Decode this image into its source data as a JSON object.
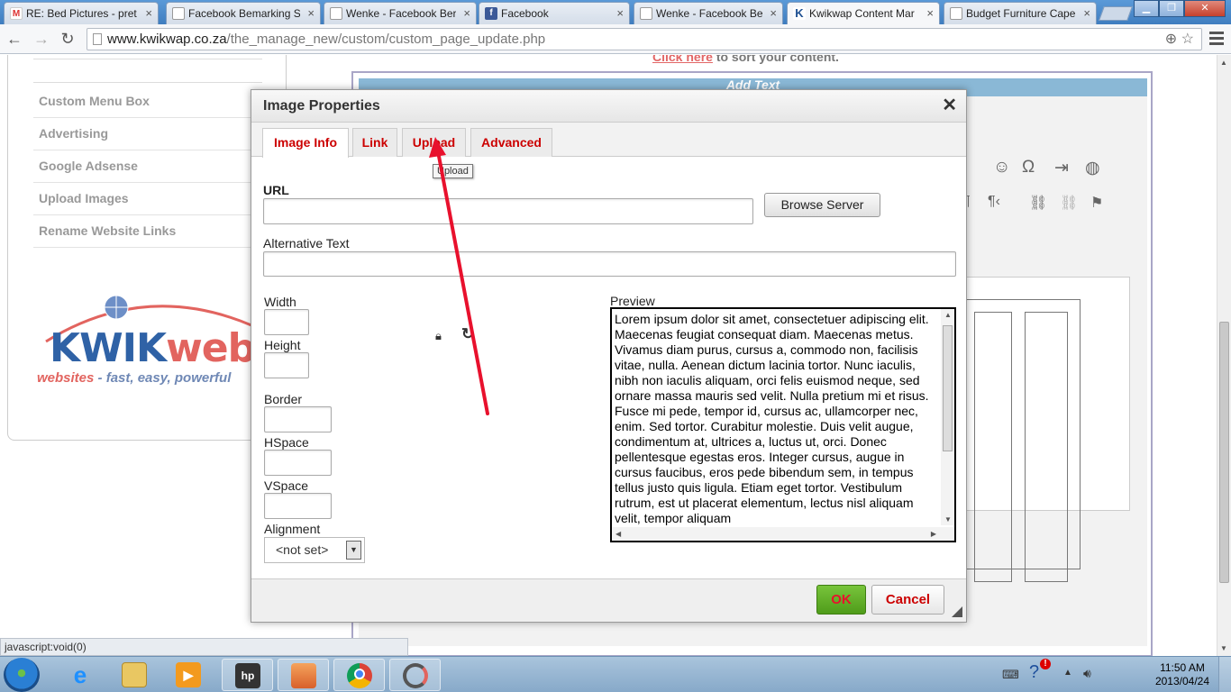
{
  "browser": {
    "tabs": [
      {
        "title": "RE: Bed Pictures - pret",
        "favicon": "gmail-icon",
        "active": false
      },
      {
        "title": "Facebook Bemarking S",
        "favicon": "document-icon",
        "active": false
      },
      {
        "title": "Wenke - Facebook Ber",
        "favicon": "document-icon",
        "active": false
      },
      {
        "title": "Facebook",
        "favicon": "facebook-icon",
        "active": false
      },
      {
        "title": "Wenke - Facebook Be",
        "favicon": "document-icon",
        "active": false
      },
      {
        "title": "Kwikwap Content Mar",
        "favicon": "kwikwap-icon",
        "active": true
      },
      {
        "title": "Budget Furniture Cape",
        "favicon": "document-icon",
        "active": false
      }
    ],
    "url_domain": "www.kwikwap.co.za",
    "url_path": "/the_manage_new/custom/custom_page_update.php",
    "status_text": "javascript:void(0)"
  },
  "sidebar": {
    "items": [
      {
        "label": "Custom Menu Box"
      },
      {
        "label": "Advertising"
      },
      {
        "label": "Google Adsense"
      },
      {
        "label": "Upload Images"
      },
      {
        "label": "Rename Website Links"
      }
    ],
    "logo_word_a": "KWIK",
    "logo_word_b": "web",
    "logo_tag_a": "websites",
    "logo_tag_b": " - fast, easy, powerful"
  },
  "main": {
    "sort_link": "Click here",
    "sort_text": " to sort your content.",
    "editor_header": "Add Text"
  },
  "dialog": {
    "title": "Image Properties",
    "tabs": [
      {
        "label": "Image Info",
        "active": true
      },
      {
        "label": "Link",
        "active": false
      },
      {
        "label": "Upload",
        "active": false
      },
      {
        "label": "Advanced",
        "active": false
      }
    ],
    "tooltip": "Upload",
    "url_label": "URL",
    "url_value": "",
    "browse_button": "Browse Server",
    "alt_label": "Alternative Text",
    "alt_value": "",
    "width_label": "Width",
    "height_label": "Height",
    "border_label": "Border",
    "hspace_label": "HSpace",
    "vspace_label": "VSpace",
    "alignment_label": "Alignment",
    "alignment_value": "<not set>",
    "preview_label": "Preview",
    "preview_text": "Lorem ipsum dolor sit amet, consectetuer adipiscing elit. Maecenas feugiat consequat diam. Maecenas metus. Vivamus diam purus, cursus a, commodo non, facilisis vitae, nulla. Aenean dictum lacinia tortor. Nunc iaculis, nibh non iaculis aliquam, orci felis euismod neque, sed ornare massa mauris sed velit. Nulla pretium mi et risus. Fusce mi pede, tempor id, cursus ac, ullamcorper nec, enim. Sed tortor. Curabitur molestie. Duis velit augue, condimentum at, ultrices a, luctus ut, orci. Donec pellentesque egestas eros. Integer cursus, augue in cursus faucibus, eros pede bibendum sem, in tempus tellus justo quis ligula. Etiam eget tortor. Vestibulum rutrum, est ut placerat elementum, lectus nisl aliquam velit, tempor aliquam",
    "ok_button": "OK",
    "cancel_button": "Cancel"
  },
  "taskbar": {
    "apps": [
      "internet-explorer-icon",
      "file-explorer-icon",
      "media-player-icon",
      "hp-icon",
      "messenger-icon",
      "chrome-icon",
      "app-icon"
    ],
    "time": "11:50 AM",
    "date": "2013/04/24"
  },
  "colors": {
    "dialog_tab_text": "#cc0000",
    "ok_bg": "#5fae25",
    "annotation_arrow": "#e8112d"
  }
}
